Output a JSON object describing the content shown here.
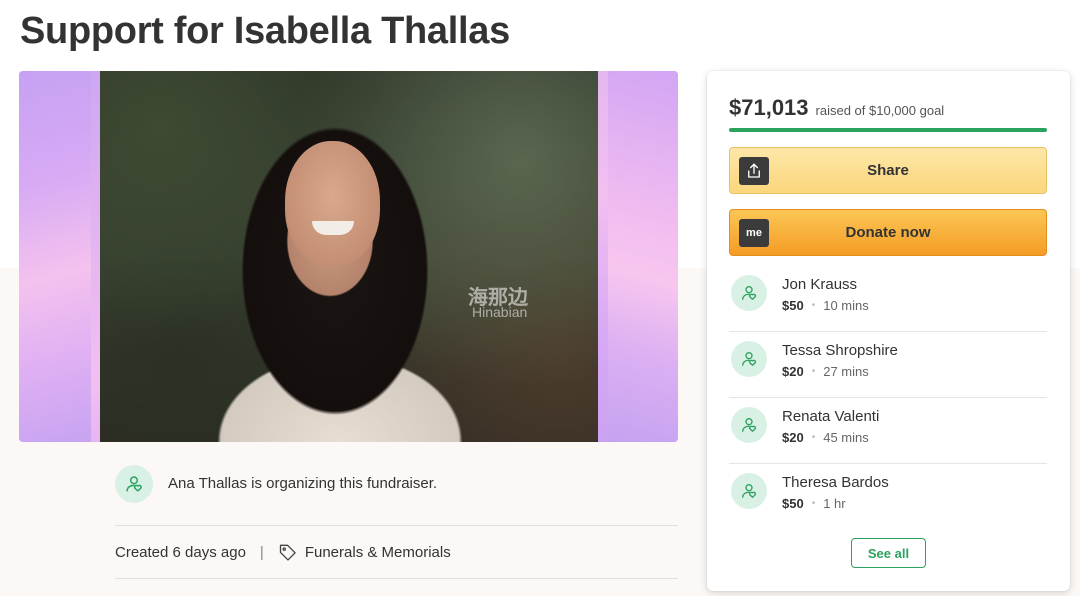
{
  "page": {
    "title": "Support for Isabella Thallas"
  },
  "hero": {
    "watermark_cn": "海那边",
    "watermark_en": "Hinabian"
  },
  "organizer": {
    "text": "Ana Thallas is organizing this fundraiser."
  },
  "meta": {
    "created": "Created 6 days ago",
    "separator": "|",
    "category": "Funerals & Memorials"
  },
  "donation": {
    "raised_amount": "$71,013",
    "goal_text": "raised of $10,000 goal",
    "progress_fraction": 1.0,
    "share_label": "Share",
    "donate_label": "Donate now",
    "donate_icon_text": "me",
    "see_all_label": "See all",
    "accent_color": "#2ca25f",
    "donors": [
      {
        "name": "Jon Krauss",
        "amount": "$50",
        "time": "10 mins"
      },
      {
        "name": "Tessa Shropshire",
        "amount": "$20",
        "time": "27 mins"
      },
      {
        "name": "Renata Valenti",
        "amount": "$20",
        "time": "45 mins"
      },
      {
        "name": "Theresa Bardos",
        "amount": "$50",
        "time": "1 hr"
      }
    ],
    "dot": "•"
  }
}
